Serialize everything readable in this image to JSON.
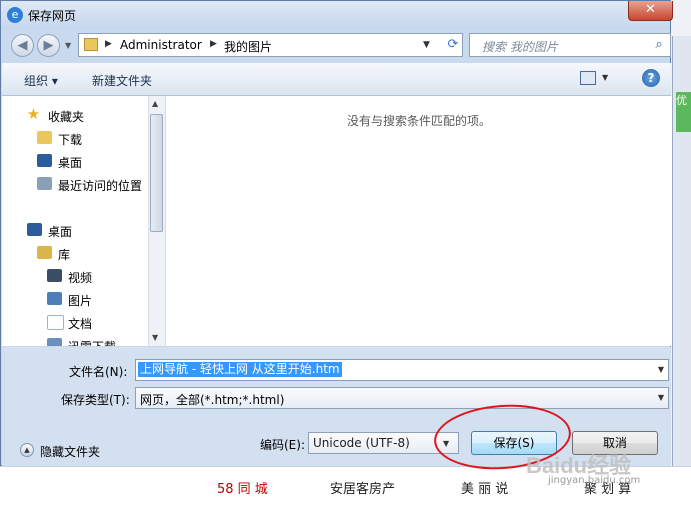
{
  "background": {
    "links": [
      "58 同 城",
      "安居客房产",
      "美 丽 说",
      "聚 划 算"
    ],
    "right_tab": "优"
  },
  "dialog": {
    "title": "保存网页",
    "close": "✕"
  },
  "address_bar": {
    "crumbs": [
      "Administrator",
      "我的图片"
    ],
    "search_placeholder": "搜索 我的图片"
  },
  "toolbar": {
    "organize": "组织 ▾",
    "new_folder": "新建文件夹",
    "help": "?"
  },
  "nav_pane": {
    "items": [
      {
        "label": "收藏夹",
        "icon": "star-icon",
        "color": "#e6b422"
      },
      {
        "label": "下载",
        "icon": "download-folder-icon",
        "color": "#e9c75c"
      },
      {
        "label": "桌面",
        "icon": "desktop-icon",
        "color": "#2b5d9c"
      },
      {
        "label": "最近访问的位置",
        "icon": "recent-places-icon",
        "color": "#8aa0b8"
      },
      {
        "label": "桌面",
        "icon": "desktop-icon",
        "color": "#2b5d9c"
      },
      {
        "label": "库",
        "icon": "library-icon",
        "color": "#d9b54a"
      },
      {
        "label": "视频",
        "icon": "video-icon",
        "color": "#3b4e68"
      },
      {
        "label": "图片",
        "icon": "pictures-icon",
        "color": "#4d7fb8"
      },
      {
        "label": "文档",
        "icon": "documents-icon",
        "color": "#9fb3c9"
      },
      {
        "label": "迅雷下载",
        "icon": "thunder-download-icon",
        "color": "#6b8fbf"
      }
    ]
  },
  "content": {
    "empty_message": "没有与搜索条件匹配的项。"
  },
  "form": {
    "filename_label": "文件名(N):",
    "filename_value": "上网导航 - 轻快上网 从这里开始.htm",
    "filetype_label": "保存类型(T):",
    "filetype_value": "网页，全部(*.htm;*.html)",
    "hide_folders": "隐藏文件夹",
    "encoding_label": "编码(E):",
    "encoding_value": "Unicode (UTF-8)",
    "save": "保存(S)",
    "cancel": "取消"
  },
  "watermark": {
    "text": "Baidu经验",
    "url": "jingyan.baidu.com"
  }
}
